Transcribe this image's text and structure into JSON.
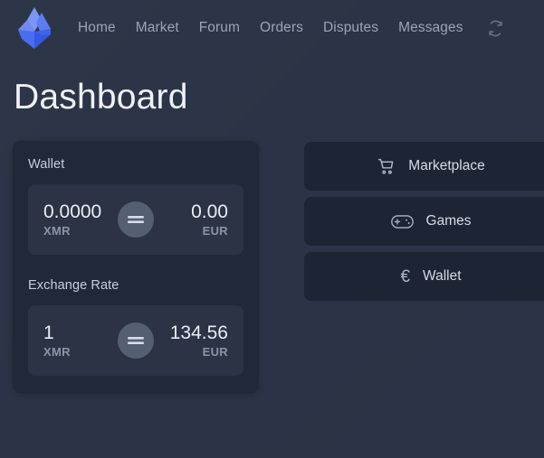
{
  "theme": {
    "background": "#2b3446",
    "panel_background": "#212838",
    "inner_box_background": "#2b3345",
    "button_background": "#1d2433",
    "accent_blue": "#4a6df0",
    "badge_gray": "#555f72",
    "muted_text": "#8c95a8",
    "nav_text": "#9aa4b6",
    "primary_text": "#e9edf4"
  },
  "navbar": {
    "logo_name": "flame-logo",
    "links": [
      {
        "label": "Home"
      },
      {
        "label": "Market"
      },
      {
        "label": "Forum"
      },
      {
        "label": "Orders"
      },
      {
        "label": "Disputes"
      },
      {
        "label": "Messages"
      }
    ],
    "refresh_icon": "refresh-icon"
  },
  "page": {
    "title": "Dashboard"
  },
  "wallet_panel": {
    "wallet_label": "Wallet",
    "wallet_rate": {
      "left_amount": "0.0000",
      "left_unit": "XMR",
      "operator": "=",
      "right_amount": "0.00",
      "right_unit": "EUR"
    },
    "exchange_label": "Exchange Rate",
    "exchange_rate": {
      "left_amount": "1",
      "left_unit": "XMR",
      "operator": "=",
      "right_amount": "134.56",
      "right_unit": "EUR"
    }
  },
  "actions": [
    {
      "label": "Marketplace",
      "icon": "shopping-cart-icon"
    },
    {
      "label": "Games",
      "icon": "gamepad-icon"
    },
    {
      "label": "Wallet",
      "icon": "euro-icon",
      "glyph": "€"
    }
  ]
}
